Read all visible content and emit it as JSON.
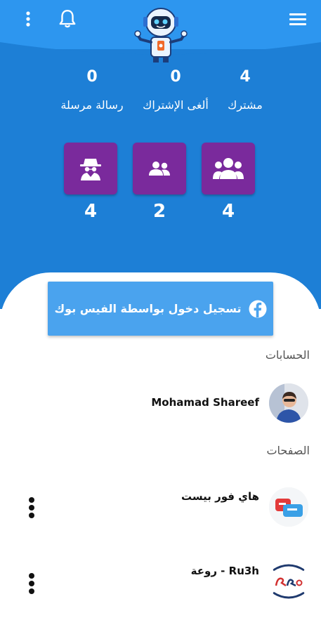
{
  "colors": {
    "header_top": "#2d96ef",
    "header_main": "#1d7fd6",
    "tile": "#7a2a9c",
    "facebook_button": "#4aa3ee"
  },
  "header": {
    "menu_icon": "hamburger-icon",
    "notifications_icon": "bell-icon",
    "more_icon": "vertical-dots-icon",
    "logo": "robot-logo"
  },
  "stats": [
    {
      "value": "4",
      "label": "مشترك"
    },
    {
      "value": "0",
      "label": "ألغى الإشتراك"
    },
    {
      "value": "0",
      "label": "رسالة مرسلة"
    }
  ],
  "tiles": [
    {
      "icon": "group-icon",
      "value": "4"
    },
    {
      "icon": "people-icon",
      "value": "2"
    },
    {
      "icon": "spy-icon",
      "value": "4"
    }
  ],
  "facebook_login": {
    "label": "تسجيل دخول بواسطة الفيس بوك",
    "icon": "facebook-icon"
  },
  "accounts": {
    "title": "الحسابات",
    "items": [
      {
        "name": "Mohamad Shareef"
      }
    ]
  },
  "pages": {
    "title": "الصفحات",
    "items": [
      {
        "name": "هاي فور بيست"
      },
      {
        "name": "Ru3h - روعة"
      }
    ]
  }
}
